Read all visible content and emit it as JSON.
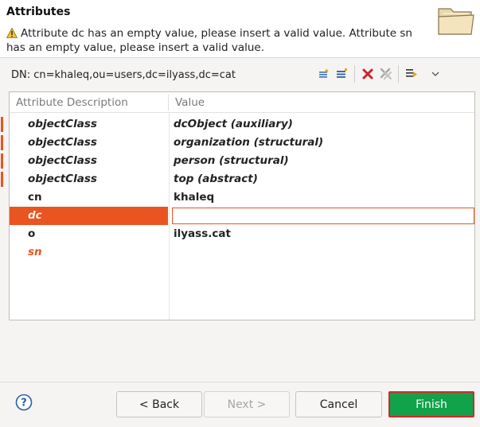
{
  "header": {
    "title": "Attributes",
    "message": "Attribute dc has an empty value, please insert a valid value. Attribute sn has an empty value, please insert a valid value.",
    "icon": "warning-icon",
    "image_icon": "folder-icon"
  },
  "dn": {
    "label": "DN: cn=khaleq,ou=users,dc=ilyass,dc=cat"
  },
  "toolbar": {
    "buttons": [
      "new-attribute-icon",
      "new-value-icon",
      "delete-icon",
      "delete-all-icon",
      "expand-icon",
      "view-menu-icon"
    ]
  },
  "table": {
    "columns": [
      "Attribute Description",
      "Value"
    ],
    "rows": [
      {
        "attr": "objectClass",
        "value": "dcObject (auxiliary)"
      },
      {
        "attr": "objectClass",
        "value": "organization (structural)"
      },
      {
        "attr": "objectClass",
        "value": "person (structural)"
      },
      {
        "attr": "objectClass",
        "value": "top (abstract)"
      },
      {
        "attr": "cn",
        "value": "khaleq"
      },
      {
        "attr": "dc",
        "value": ""
      },
      {
        "attr": "o",
        "value": "ilyass.cat"
      },
      {
        "attr": "sn",
        "value": ""
      }
    ]
  },
  "buttons": {
    "back": "< Back",
    "next": "Next >",
    "cancel": "Cancel",
    "finish": "Finish"
  },
  "colors": {
    "accent": "#e95420",
    "finish_bg": "#12a24a",
    "finish_border": "#d8262b"
  }
}
